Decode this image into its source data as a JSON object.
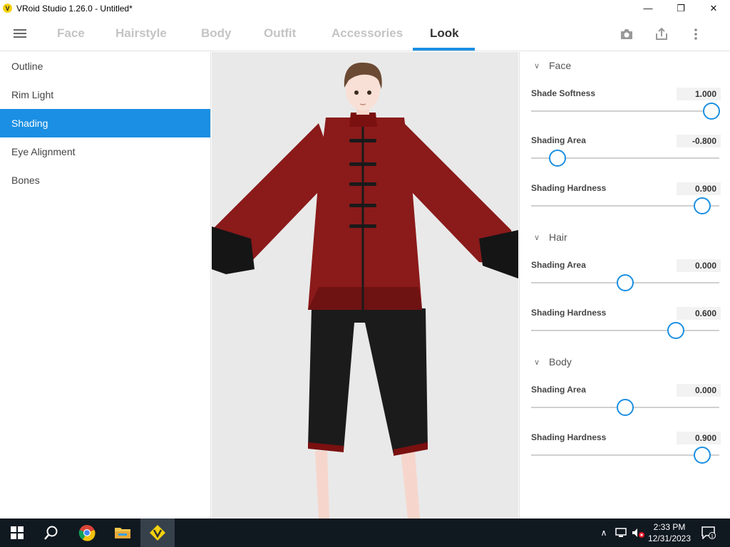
{
  "window": {
    "title": "VRoid Studio 1.26.0 - Untitled*",
    "minimize": "—",
    "maximize": "❐",
    "close": "✕"
  },
  "nav": {
    "tabs": [
      {
        "label": "Face"
      },
      {
        "label": "Hairstyle"
      },
      {
        "label": "Body"
      },
      {
        "label": "Outfit"
      },
      {
        "label": "Accessories"
      },
      {
        "label": "Look"
      }
    ],
    "active_tab": "Look",
    "icons": [
      "camera-icon",
      "share-icon",
      "more-vert-icon"
    ]
  },
  "left_menu": {
    "items": [
      {
        "label": "Outline"
      },
      {
        "label": "Rim Light"
      },
      {
        "label": "Shading"
      },
      {
        "label": "Eye Alignment"
      },
      {
        "label": "Bones"
      }
    ],
    "active": "Shading"
  },
  "right_panel": {
    "sections": [
      {
        "title": "Face",
        "params": [
          {
            "label": "Shade Softness",
            "value": "1.000",
            "fraction": 0.96
          },
          {
            "label": "Shading Area",
            "value": "-0.800",
            "fraction": 0.14
          },
          {
            "label": "Shading Hardness",
            "value": "0.900",
            "fraction": 0.91
          }
        ]
      },
      {
        "title": "Hair",
        "params": [
          {
            "label": "Shading Area",
            "value": "0.000",
            "fraction": 0.5
          },
          {
            "label": "Shading Hardness",
            "value": "0.600",
            "fraction": 0.77
          }
        ]
      },
      {
        "title": "Body",
        "params": [
          {
            "label": "Shading Area",
            "value": "0.000",
            "fraction": 0.5
          },
          {
            "label": "Shading Hardness",
            "value": "0.900",
            "fraction": 0.91
          }
        ]
      }
    ]
  },
  "taskbar": {
    "time": "2:33 PM",
    "date": "12/31/2023",
    "notification_count": "1"
  },
  "colors": {
    "accent": "#1a8fe3",
    "jacket": "#8b1a1a",
    "pants": "#1b1b1b",
    "taskbar": "#101820"
  }
}
